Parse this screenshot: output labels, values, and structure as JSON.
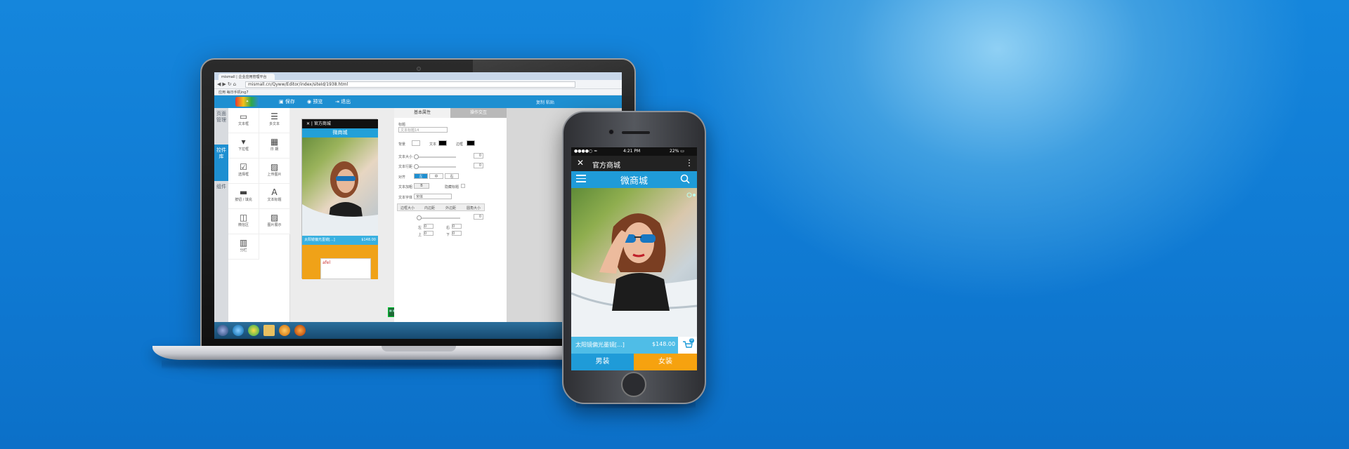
{
  "browser": {
    "tab_title": "mismall | 企业应用管理平台",
    "url": "mismall.cn/Qyww/Editor/index/siteId/1938.html",
    "bookmarks": "应用   每日手机ing7"
  },
  "toolbar": {
    "save_label": "保存",
    "preview_label": "预览",
    "exit_label": "退出",
    "right_links": "复制  粘贴"
  },
  "side_tabs": [
    "页面管理",
    "控件库",
    "组件"
  ],
  "widgets": [
    "文本框",
    "多文本",
    "下拉框",
    "日 期",
    "选择框",
    "上传图片",
    "按钮 / 填充",
    "文本标题",
    "微信区",
    "图片展示",
    "分栏"
  ],
  "editor_preview": {
    "bar_title": "官方商城",
    "header_title": "微商城",
    "product": "太阳镜偏光墨镜[...]",
    "price": "$148.00",
    "popup_text": "afel"
  },
  "props": {
    "tab_basic": "基本属性",
    "tab_action": "操作交互",
    "title_label": "标题",
    "title_placeholder": "文本标题14",
    "bg_label": "背景",
    "text_label": "文本",
    "border_label": "边框",
    "font_size_label": "文本大小",
    "line_height_label": "文本行距",
    "align_label": "对齐",
    "align_left": "左",
    "align_center": "中",
    "align_right": "右",
    "style_label": "文本加粗",
    "style_value": "B",
    "underline_label": "隐藏标题",
    "font_label": "文本字体",
    "font_value": "宋体",
    "sub_tabs": [
      "边框大小",
      "内边距",
      "外边距",
      "圆角大小"
    ],
    "pos_left": "左",
    "pos_right": "右",
    "pos_top": "上",
    "pos_bottom": "下",
    "val_zero": "0"
  },
  "phone": {
    "carrier": "●●●●○ ≈",
    "time": "4:21 PM",
    "battery": "22% ▭",
    "bar_title": "官方商城",
    "close_glyph": "✕",
    "more_glyph": "⋮",
    "header_title": "微商城",
    "product": "太阳镜偏光墨镜[...]",
    "price": "$148.00",
    "cart_badge": "0",
    "btn_men": "男装",
    "btn_women": "女装"
  },
  "colors": {
    "primary_blue": "#1f9bd8",
    "accent_orange": "#f6a20f",
    "background_blue": "#1586dc"
  }
}
